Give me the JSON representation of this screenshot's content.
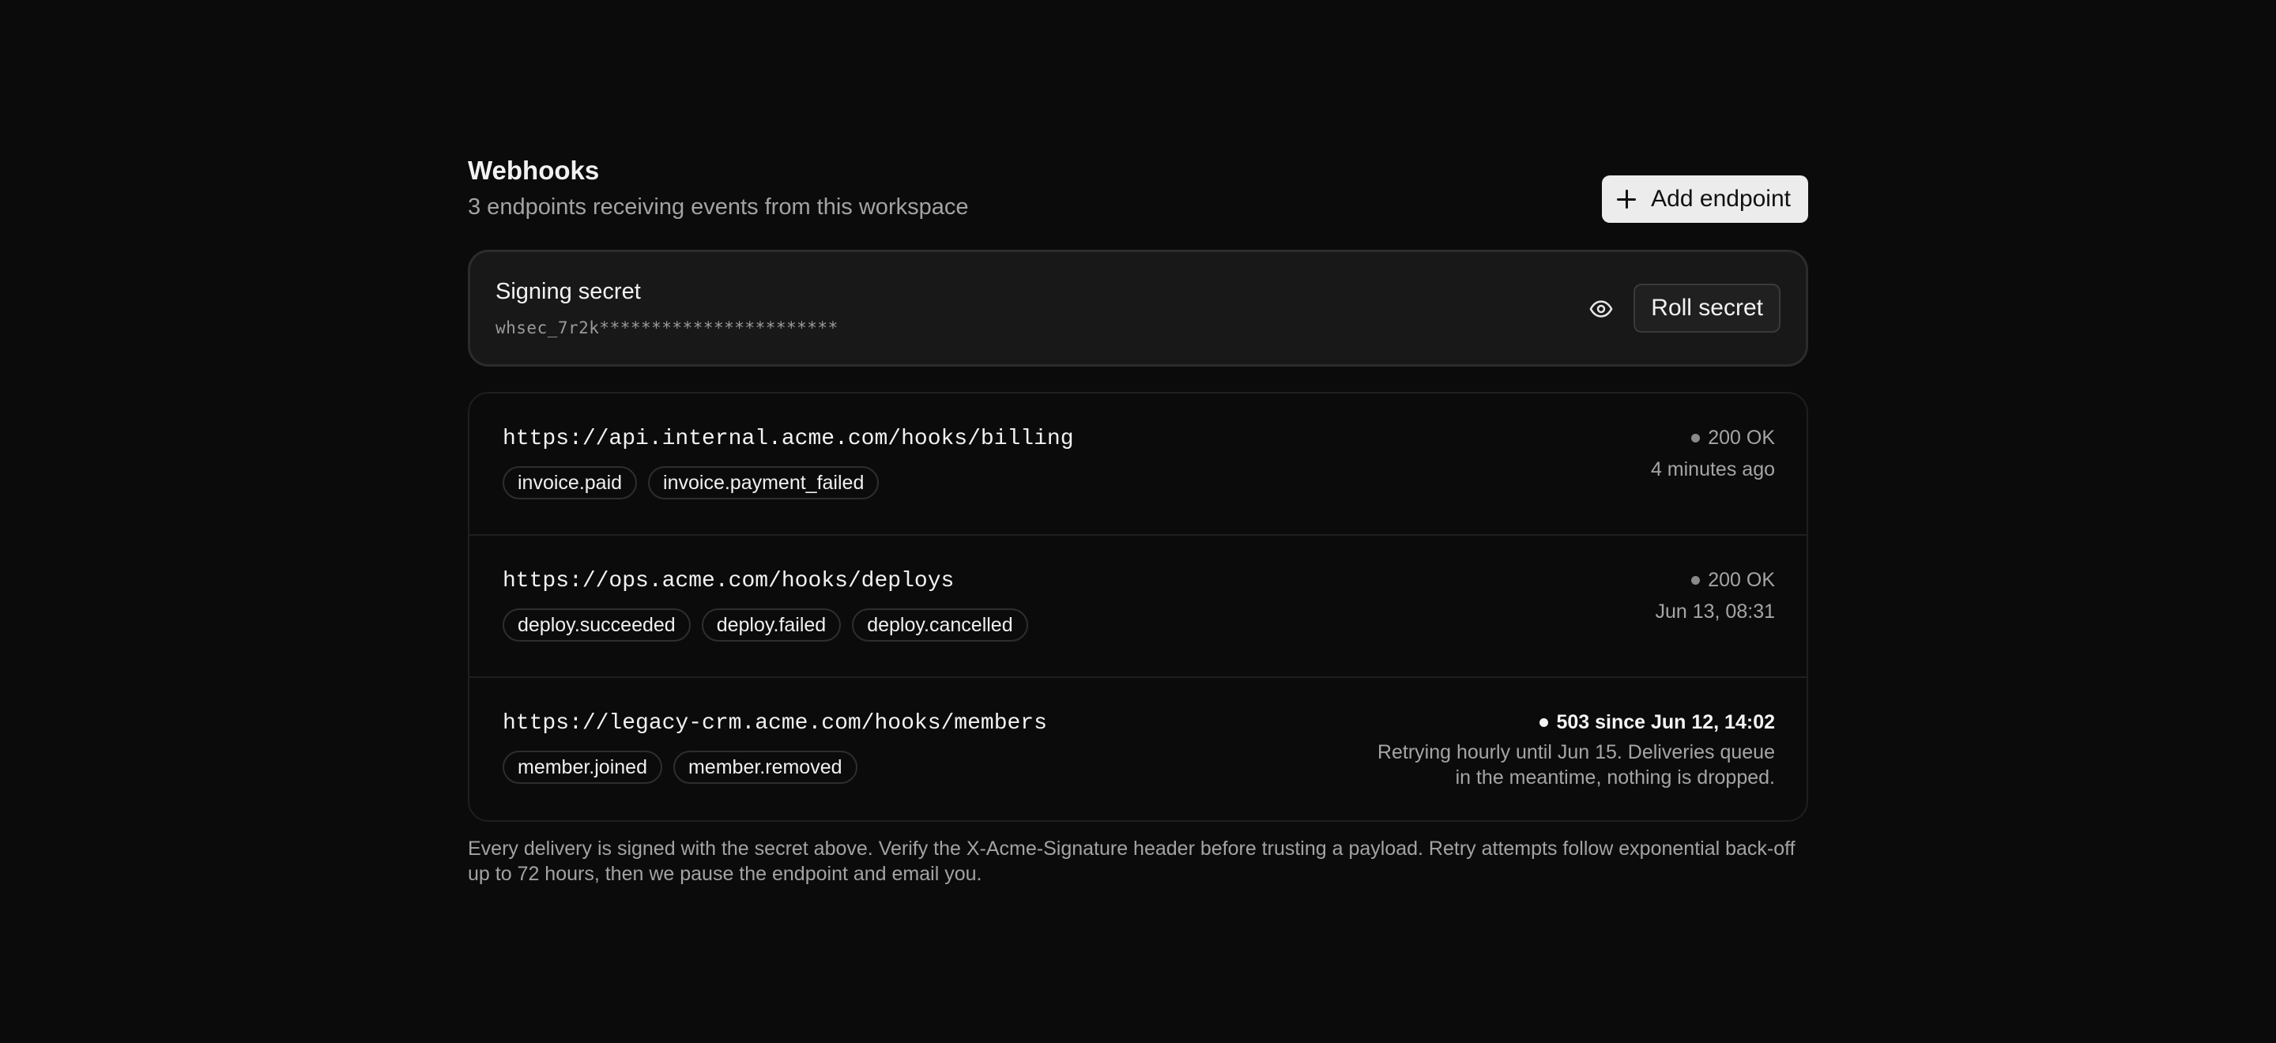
{
  "header": {
    "title": "Webhooks",
    "subtitle": "3 endpoints receiving events from this workspace",
    "add_button_label": "Add endpoint",
    "add_icon": "plus-icon"
  },
  "secret": {
    "label": "Signing secret",
    "value": "whsec_7r2k***********************",
    "reveal_icon": "eye-icon",
    "roll_button_label": "Roll secret"
  },
  "endpoints": [
    {
      "url": "https://api.internal.acme.com/hooks/billing",
      "events": [
        "invoice.paid",
        "invoice.payment_failed"
      ],
      "status": "200 OK",
      "time": "4 minutes ago"
    },
    {
      "url": "https://ops.acme.com/hooks/deploys",
      "events": [
        "deploy.succeeded",
        "deploy.failed",
        "deploy.cancelled"
      ],
      "status": "200 OK",
      "time": "Jun 13, 08:31"
    },
    {
      "url": "https://legacy-crm.acme.com/hooks/members",
      "events": [
        "member.joined",
        "member.removed"
      ],
      "status": "503 since Jun 12, 14:02",
      "note": "Retrying hourly until Jun 15. Deliveries queue in the meantime, nothing is dropped."
    }
  ],
  "footnote": "Every delivery is signed with the secret above. Verify the X-Acme-Signature header before trusting a payload. Retry attempts follow exponential back-off up to 72 hours, then we pause the endpoint and email you.",
  "colors": {
    "background": "#0b0b0b",
    "card": "#181818",
    "primary_button": "#ececec",
    "muted_text": "#a5a5a5"
  }
}
